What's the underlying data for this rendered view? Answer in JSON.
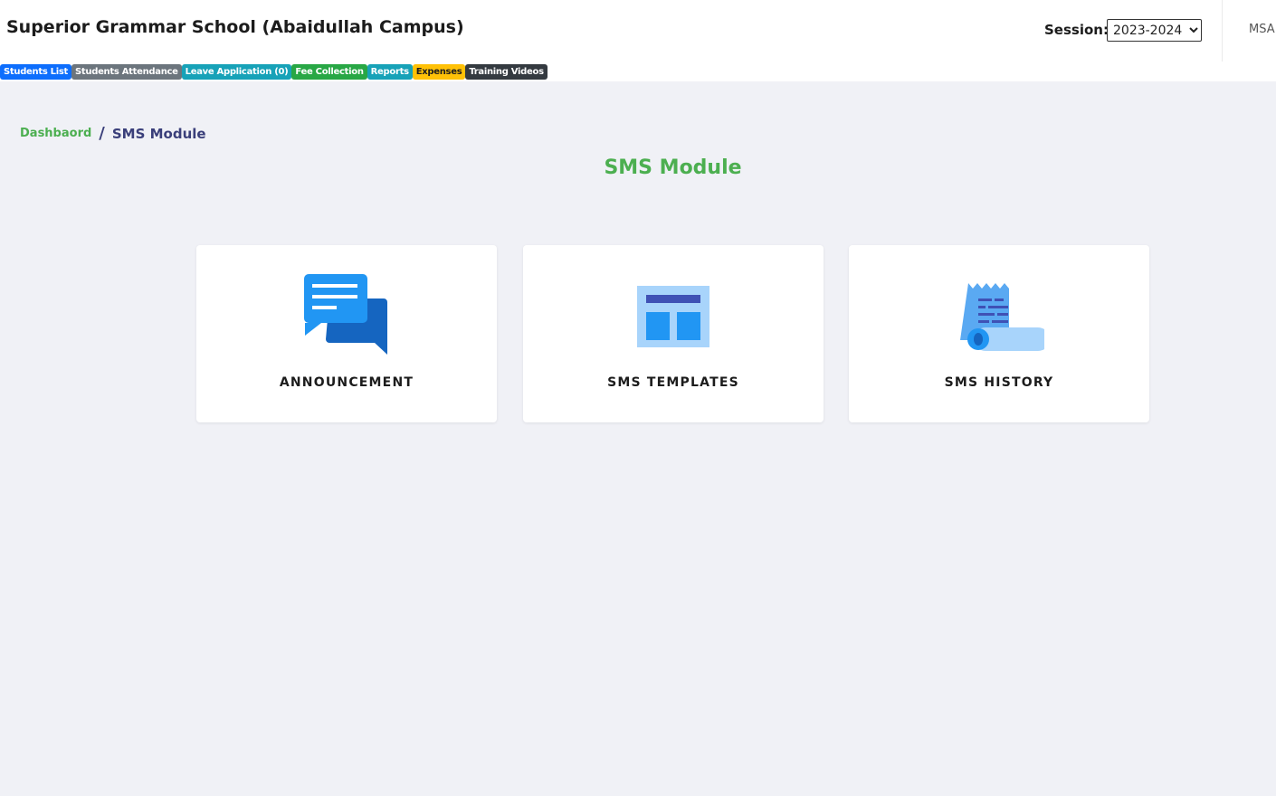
{
  "header": {
    "school_name": "Superior Grammar School (Abaidullah Campus)",
    "session_label": "Session:",
    "session_value": "2023-2024",
    "user_label": "MSA"
  },
  "quick_nav": [
    {
      "label": "Students List",
      "color": "#0d6efd"
    },
    {
      "label": "Students Attendance",
      "color": "#6c757d"
    },
    {
      "label": "Leave Application (0)",
      "color": "#17a2b8"
    },
    {
      "label": "Fee Collection",
      "color": "#28a745"
    },
    {
      "label": "Reports",
      "color": "#17a2b8"
    },
    {
      "label": "Expenses",
      "color": "#ffc107"
    },
    {
      "label": "Training Videos",
      "color": "#343a40"
    }
  ],
  "breadcrumb": {
    "home": "Dashbaord",
    "separator": "/",
    "current": "SMS Module"
  },
  "page_title": "SMS Module",
  "cards": [
    {
      "label": "ANNOUNCEMENT",
      "icon": "chat-bubbles-icon"
    },
    {
      "label": "SMS TEMPLATES",
      "icon": "template-layout-icon"
    },
    {
      "label": "SMS HISTORY",
      "icon": "receipt-scroll-icon"
    }
  ],
  "colors": {
    "accent_green": "#4caf50",
    "breadcrumb_navy": "#3a3f7a",
    "page_bg": "#f0f1f6",
    "icon_blue": "#2196f3",
    "icon_dark_blue": "#1565c0",
    "icon_light_blue": "#a8d4fb",
    "icon_indigo": "#3f51b5"
  }
}
